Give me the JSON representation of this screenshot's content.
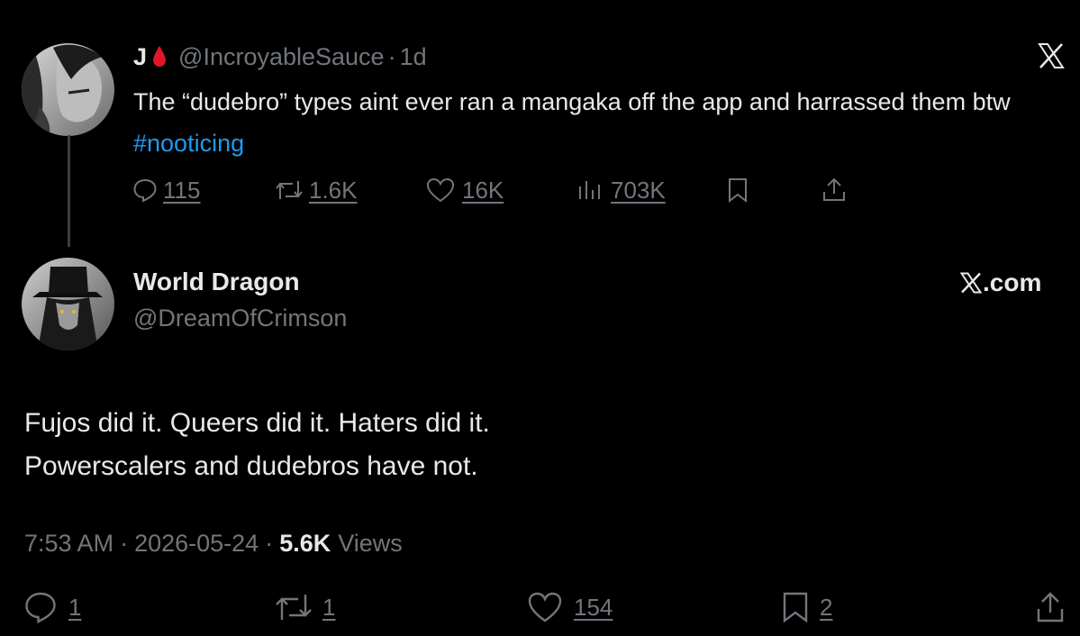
{
  "quoted_tweet": {
    "display_name": "J",
    "handle": "@IncroyableSauce",
    "separator": "·",
    "age": "1d",
    "text": "The “dudebro” types aint ever ran a mangaka off the app and harrassed them btw ",
    "hashtag": "#nooticing",
    "replies": "115",
    "reposts": "1.6K",
    "likes": "16K",
    "views": "703K",
    "brand_icon": "x-logo-icon"
  },
  "reply_tweet": {
    "display_name": "World Dragon",
    "handle": "@DreamOfCrimson",
    "watermark": "X.com",
    "text_line1": "Fujos did it. Queers did it. Haters did it.",
    "text_line2": "Powerscalers and dudebros have not.",
    "time": "7:53 AM",
    "date": "2026-05-24",
    "views_count": "5.6K",
    "views_label": "Views",
    "meta_sep": "·",
    "replies": "1",
    "reposts": "1",
    "likes": "154",
    "bookmarks": "2"
  },
  "colors": {
    "background": "#000000",
    "text": "#e7e9ea",
    "muted": "#71767b",
    "link": "#1d9bf0",
    "blood_drop": "#e0162b"
  }
}
